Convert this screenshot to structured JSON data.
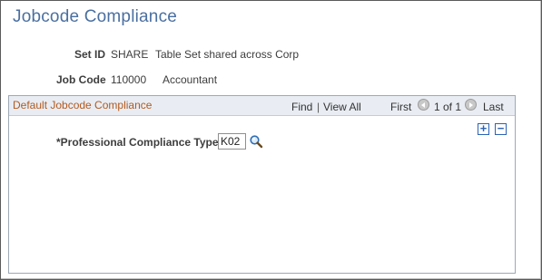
{
  "page": {
    "title": "Jobcode Compliance"
  },
  "header_fields": {
    "setid_label": "Set ID",
    "setid_value": "SHARE",
    "setid_desc": "Table Set shared across Corp",
    "jobcode_label": "Job Code",
    "jobcode_value": "110000",
    "jobcode_desc": "Accountant"
  },
  "group": {
    "title": "Default Jobcode Compliance",
    "find_label": "Find",
    "separator": "|",
    "view_all_label": "View All",
    "first_label": "First",
    "page_count": "1 of 1",
    "last_label": "Last",
    "add_row_label": "+",
    "delete_row_label": "−",
    "field_label": "*Professional Compliance Type",
    "field_value": "K02",
    "lookup_icon": "magnifier-icon"
  },
  "colors": {
    "title": "#4a6fa0",
    "group_title": "#b35a1f",
    "link": "#2a55a5"
  }
}
